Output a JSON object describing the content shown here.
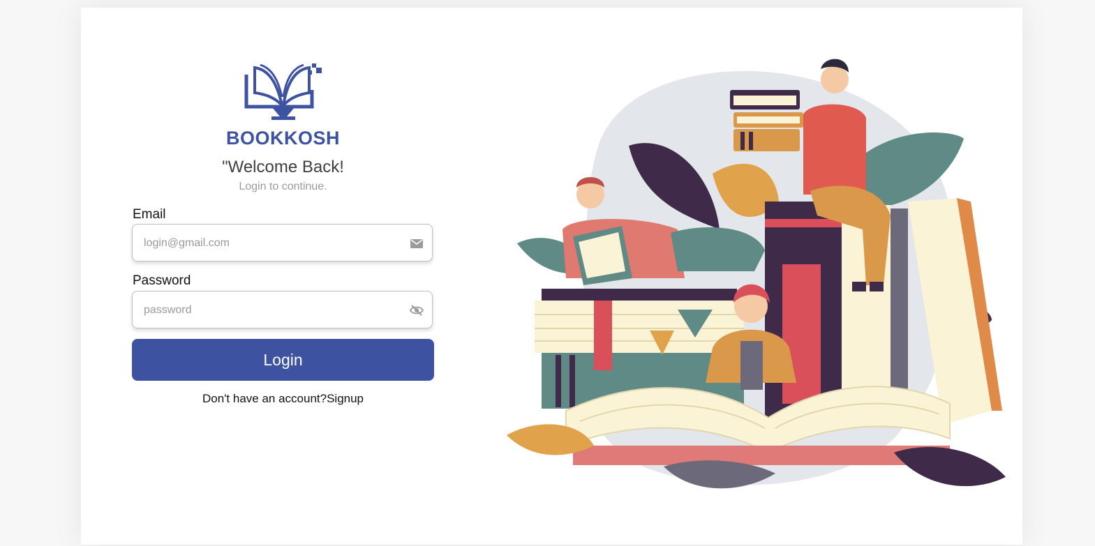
{
  "brand": {
    "name": "BOOKKOSH",
    "color": "#3d52a0"
  },
  "welcome": {
    "title": "\"Welcome Back!",
    "subtitle": "Login to continue."
  },
  "form": {
    "email_label": "Email",
    "email_placeholder": "login@gmail.com",
    "email_value": "",
    "email_icon": "mail-icon",
    "password_label": "Password",
    "password_placeholder": "password",
    "password_value": "",
    "password_icon": "eye-off-icon",
    "login_label": "Login"
  },
  "signup": {
    "prompt": "Don't have an account?",
    "link_label": "Signup"
  },
  "colors": {
    "accent": "#3d52a0",
    "card": "#ffffff",
    "background": "#f7f7f7"
  },
  "illustration": {
    "description_icon": "reading-people-books-illustration"
  }
}
